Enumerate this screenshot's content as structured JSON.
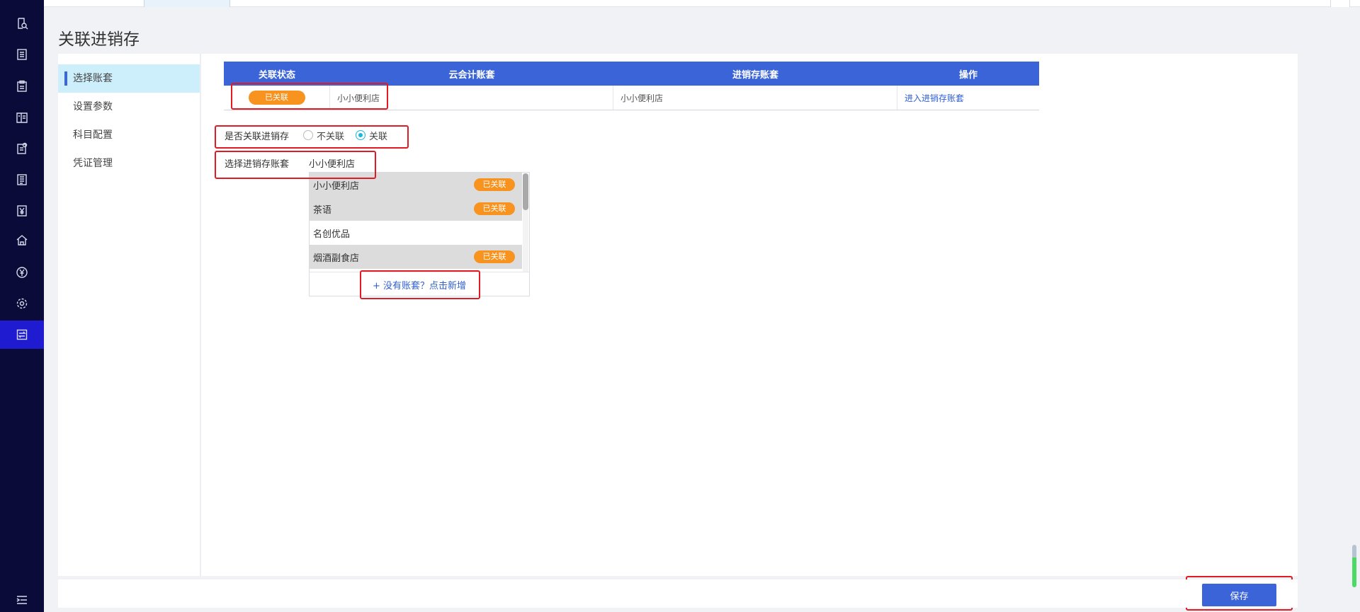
{
  "page_title": "关联进销存",
  "sidebar_icons": [
    "search-doc-icon",
    "list-icon",
    "clipboard-icon",
    "ledger-icon",
    "settings-doc-icon",
    "report-icon",
    "yen-doc-icon",
    "home-icon",
    "yen-circle-icon",
    "gear-icon",
    "transfer-icon",
    "menu-icon"
  ],
  "subnav": {
    "items": [
      "选择账套",
      "设置参数",
      "科目配置",
      "凭证管理"
    ]
  },
  "table": {
    "headers": [
      "关联状态",
      "云会计账套",
      "进销存账套",
      "操作"
    ],
    "row": {
      "status": "已关联",
      "cloud_account": "小小便利店",
      "inventory_account": "小小便利店",
      "action": "进入进销存账套"
    }
  },
  "link_option": {
    "label": "是否关联进销存",
    "opt_no": "不关联",
    "opt_yes": "关联",
    "selected": "关联"
  },
  "select_account": {
    "label": "选择进销存账套",
    "value": "小小便利店"
  },
  "dropdown": {
    "items": [
      {
        "name": "小小便利店",
        "badge": "已关联"
      },
      {
        "name": "茶语",
        "badge": "已关联"
      },
      {
        "name": "名创优品",
        "badge": ""
      },
      {
        "name": "烟酒副食店",
        "badge": "已关联"
      }
    ],
    "footer": "+ 没有账套？点击新增"
  },
  "save_label": "保存",
  "colors": {
    "sidebar_bg": "#0b0b3a",
    "header_blue": "#3b64d9",
    "badge_orange": "#f7931e",
    "highlight_red": "#e01b24"
  }
}
